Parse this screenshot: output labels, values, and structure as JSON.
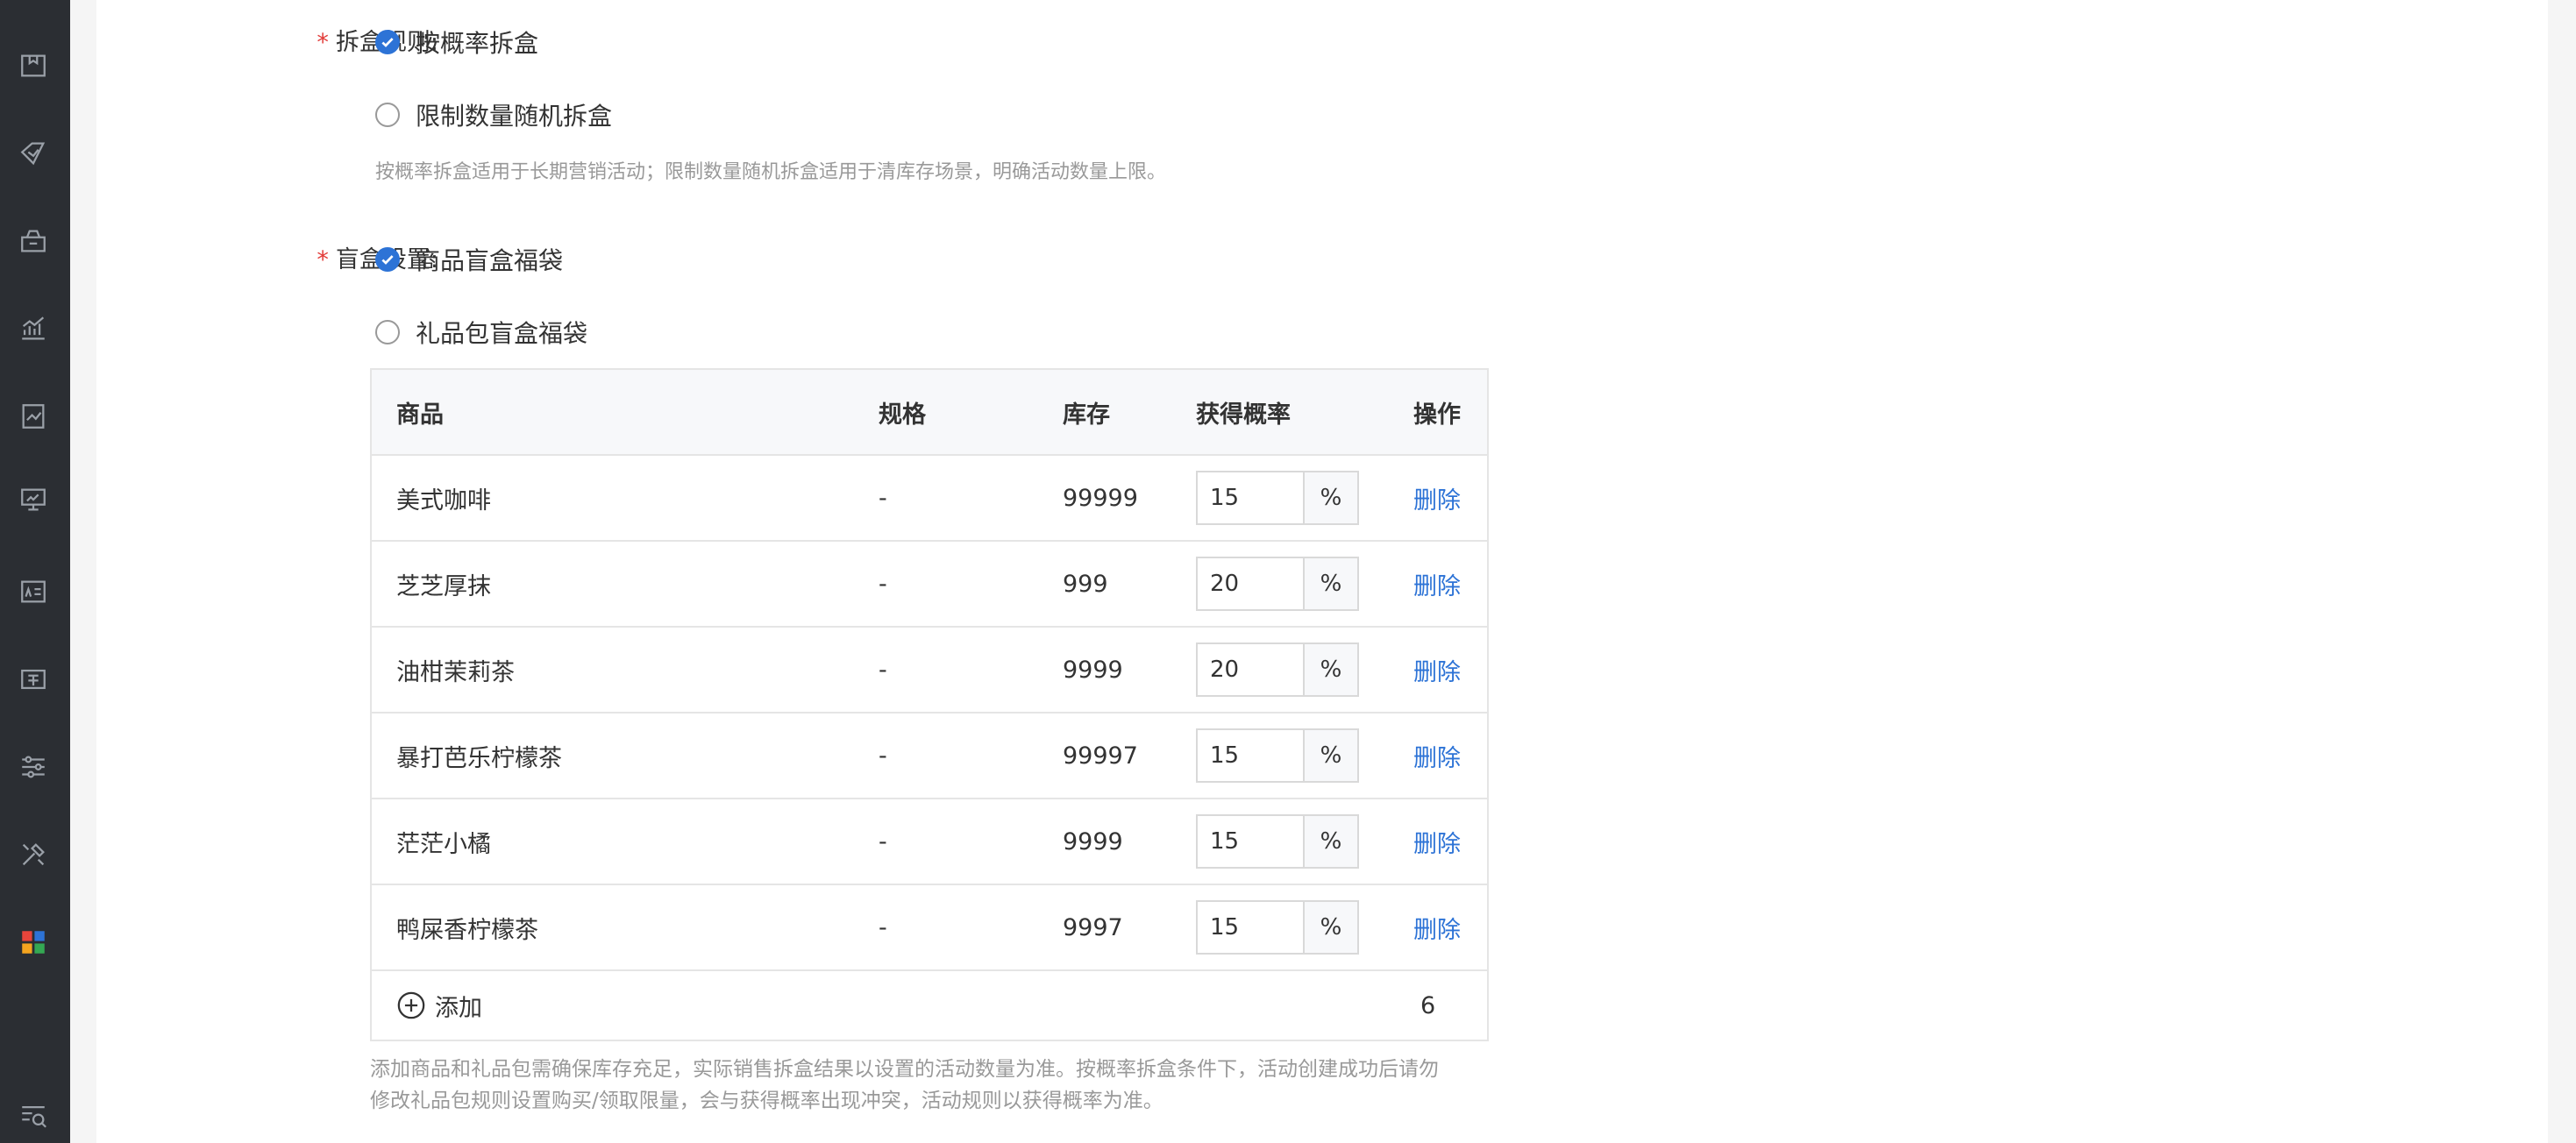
{
  "sidebar": {
    "icons": [
      "package-icon",
      "tag-icon",
      "voucher-icon",
      "trend-chart-icon",
      "report-icon",
      "monitor-icon",
      "card-icon",
      "ticket-icon",
      "sliders-icon",
      "tools-icon",
      "apps-icon",
      "search-list-icon"
    ],
    "accent_colors": [
      "#e7453b",
      "#34a853",
      "#f4a41f",
      "#2d73d6"
    ]
  },
  "split_rule": {
    "label": "拆盒规则:",
    "required_mark": "*",
    "options": [
      {
        "label": "按概率拆盒",
        "checked": true
      },
      {
        "label": "限制数量随机拆盒",
        "checked": false
      }
    ],
    "hint": "按概率拆盒适用于长期营销活动；限制数量随机拆盒适用于清库存场景，明确活动数量上限。"
  },
  "box_setting": {
    "label": "盲盒设置:",
    "required_mark": "*",
    "options": [
      {
        "label": "商品盲盒福袋",
        "checked": true
      },
      {
        "label": "礼品包盲盒福袋",
        "checked": false
      }
    ]
  },
  "table": {
    "headers": {
      "name": "商品",
      "spec": "规格",
      "stock": "库存",
      "rate": "获得概率",
      "op": "操作"
    },
    "rows": [
      {
        "name": "美式咖啡",
        "spec": "-",
        "stock": "99999",
        "rate": "15",
        "unit": "%",
        "op": "删除"
      },
      {
        "name": "芝芝厚抹",
        "spec": "-",
        "stock": "999",
        "rate": "20",
        "unit": "%",
        "op": "删除"
      },
      {
        "name": "油柑茉莉茶",
        "spec": "-",
        "stock": "9999",
        "rate": "20",
        "unit": "%",
        "op": "删除"
      },
      {
        "name": "暴打芭乐柠檬茶",
        "spec": "-",
        "stock": "99997",
        "rate": "15",
        "unit": "%",
        "op": "删除"
      },
      {
        "name": "茫茫小橘",
        "spec": "-",
        "stock": "9999",
        "rate": "15",
        "unit": "%",
        "op": "删除"
      },
      {
        "name": "鸭屎香柠檬茶",
        "spec": "-",
        "stock": "9997",
        "rate": "15",
        "unit": "%",
        "op": "删除"
      }
    ],
    "add_label": "添加",
    "count": "6"
  },
  "note": {
    "line1": "添加商品和礼品包需确保库存充足，实际销售拆盒结果以设置的活动数量为准。按概率拆盒条件下，活动创建成功后请勿",
    "line2": "修改礼品包规则设置购买/领取限量，会与获得概率出现冲突，活动规则以获得概率为准。"
  },
  "colors": {
    "link": "#2d73d6",
    "required": "#e23c39",
    "sidebar_bg": "#2b2e33"
  }
}
